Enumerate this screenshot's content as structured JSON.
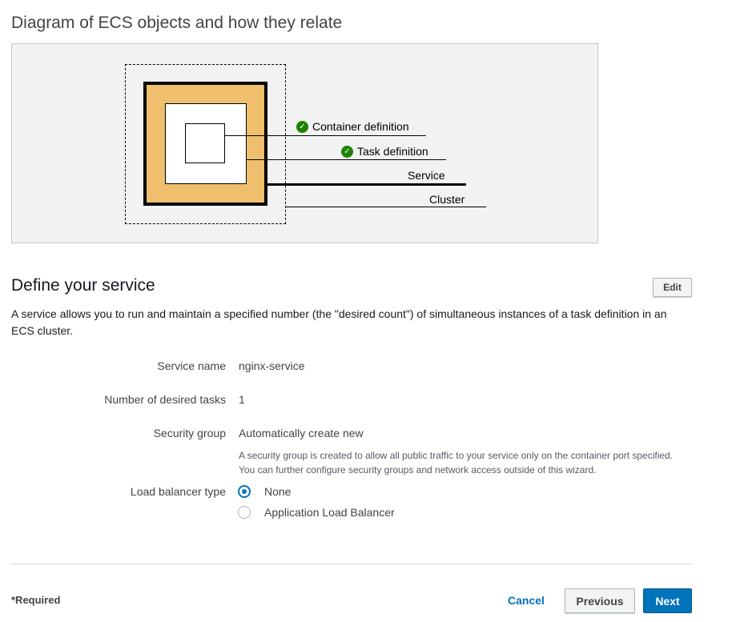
{
  "diagram": {
    "title": "Diagram of ECS objects and how they relate",
    "labels": {
      "container_definition": "Container definition",
      "task_definition": "Task definition",
      "service": "Service",
      "cluster": "Cluster"
    }
  },
  "service": {
    "title": "Define your service",
    "edit_label": "Edit",
    "description": "A service allows you to run and maintain a specified number (the \"desired count\") of simultaneous instances of a task definition in an ECS cluster.",
    "fields": {
      "service_name_label": "Service name",
      "service_name_value": "nginx-service",
      "desired_tasks_label": "Number of desired tasks",
      "desired_tasks_value": "1",
      "security_group_label": "Security group",
      "security_group_value": "Automatically create new",
      "security_group_help": "A security group is created to allow all public traffic to your service only on the container port specified. You can further configure security groups and network access outside of this wizard.",
      "load_balancer_label": "Load balancer type",
      "load_balancer_options": [
        "None",
        "Application Load Balancer"
      ],
      "load_balancer_selected": "None"
    }
  },
  "footer": {
    "required": "*Required",
    "cancel": "Cancel",
    "previous": "Previous",
    "next": "Next"
  },
  "colors": {
    "accent": "#0073bb",
    "service_fill": "#f0bf6e",
    "check_green": "#1d8102"
  }
}
